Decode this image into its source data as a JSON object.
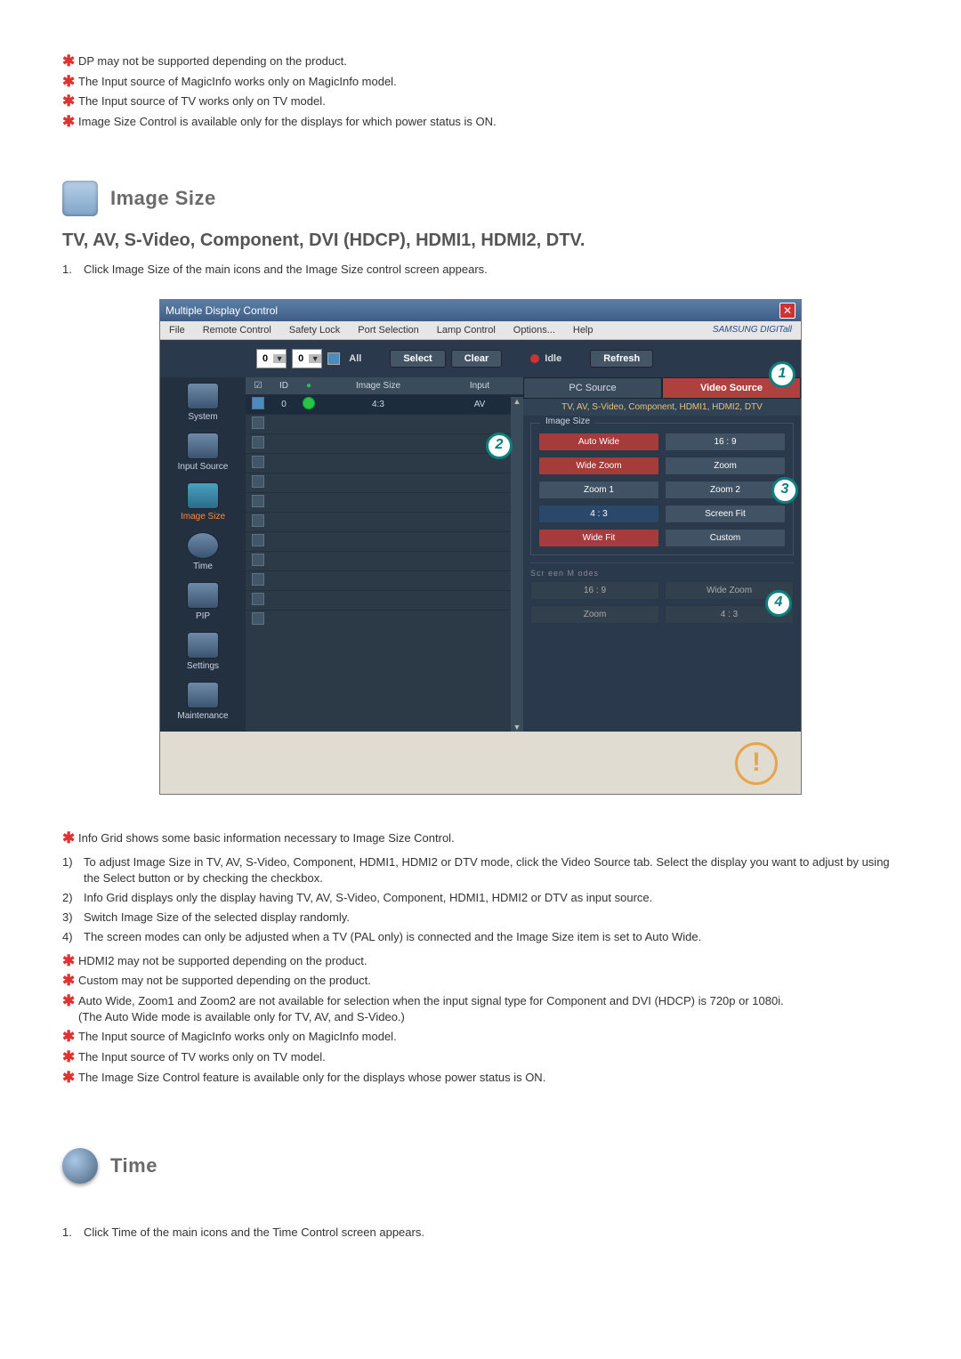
{
  "top_notes": [
    "DP may not be supported depending on the product.",
    "The Input source of MagicInfo works only on MagicInfo model.",
    "The Input source of TV works only on TV model.",
    "Image Size Control is available only for the displays for which power status is ON."
  ],
  "section_image_size": {
    "title": "Image Size",
    "subtitle": "TV, AV, S-Video, Component, DVI (HDCP), HDMI1, HDMI2, DTV.",
    "intro_num": "1.",
    "intro": "Click Image Size of the main icons and the Image Size control screen appears."
  },
  "app": {
    "window_title": "Multiple Display Control",
    "brand": "SAMSUNG DIGITall",
    "menus": [
      "File",
      "Remote Control",
      "Safety Lock",
      "Port Selection",
      "Lamp Control",
      "Options...",
      "Help"
    ],
    "toolbar": {
      "spin_a": "0",
      "spin_b": "0",
      "all_label": "All",
      "select": "Select",
      "clear": "Clear",
      "idle": "Idle",
      "refresh": "Refresh"
    },
    "sidebar": [
      {
        "label": "System"
      },
      {
        "label": "Input Source"
      },
      {
        "label": "Image Size",
        "active": true
      },
      {
        "label": "Time"
      },
      {
        "label": "PIP"
      },
      {
        "label": "Settings"
      },
      {
        "label": "Maintenance"
      }
    ],
    "grid": {
      "headers": {
        "chk": "☑",
        "id": "ID",
        "led": "●",
        "size": "Image Size",
        "input": "Input"
      },
      "row0": {
        "id": "0",
        "size": "4:3",
        "input": "AV"
      }
    },
    "tabs": {
      "pc": "PC Source",
      "video": "Video Source"
    },
    "note_line": "TV, AV, S-Video, Component, HDMI1, HDMI2, DTV",
    "group_title": "Image Size",
    "buttons": {
      "auto_wide": "Auto Wide",
      "s16_9": "16 : 9",
      "wide_zoom": "Wide Zoom",
      "zoom": "Zoom",
      "zoom1": "Zoom 1",
      "zoom2": "Zoom 2",
      "s4_3": "4 : 3",
      "screen_fit": "Screen Fit",
      "wide_fit": "Wide Fit",
      "custom": "Custom"
    },
    "dim_caption": "Scr een M odes",
    "dim_buttons": {
      "s16_9": "16 : 9",
      "wide_zoom": "Wide Zoom",
      "zoom": "Zoom",
      "s4_3": "4 : 3"
    },
    "circled": {
      "c1": "1",
      "c2": "2",
      "c3": "3",
      "c4": "4"
    }
  },
  "post_star": "Info Grid shows some basic information necessary to Image Size Control.",
  "numbered": [
    {
      "n": "1)",
      "t": "To adjust Image Size in TV, AV, S-Video, Component, HDMI1, HDMI2 or DTV mode, click the Video Source tab. Select the display you want to adjust by using the Select button or by checking the checkbox."
    },
    {
      "n": "2)",
      "t": "Info Grid displays only the display having TV, AV, S-Video, Component, HDMI1, HDMI2 or DTV as input source."
    },
    {
      "n": "3)",
      "t": "Switch Image Size of the selected display randomly."
    },
    {
      "n": "4)",
      "t": "The screen modes can only be adjusted when a TV (PAL only) is connected and the Image Size item is set to Auto Wide."
    }
  ],
  "bottom_notes": [
    "HDMI2 may not be supported depending on the product.",
    "Custom may not be supported depending on the product.",
    "Auto Wide, Zoom1 and Zoom2 are not available for selection when the input signal type for Component and DVI (HDCP) is 720p or 1080i.\n(The Auto Wide mode is available only for TV, AV, and S-Video.)",
    "The Input source of MagicInfo works only on MagicInfo model.",
    "The Input source of TV works only on TV model.",
    "The Image Size Control feature is available only for the displays whose power status is ON."
  ],
  "section_time": {
    "title": "Time",
    "intro_num": "1.",
    "intro": "Click Time of the main icons and the Time Control screen appears."
  }
}
